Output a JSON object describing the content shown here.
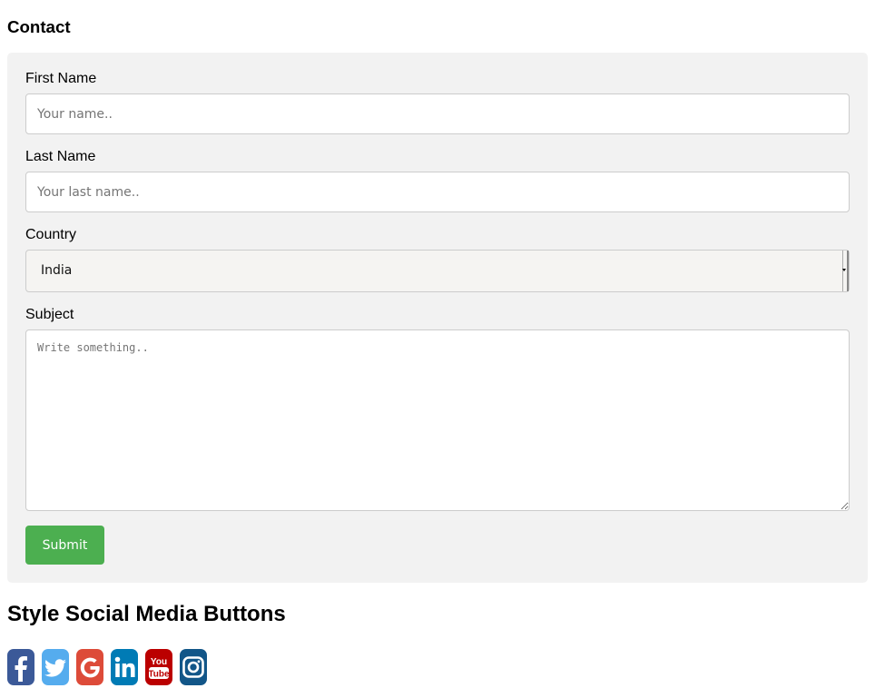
{
  "contact": {
    "title": "Contact",
    "first_name": {
      "label": "First Name",
      "placeholder": "Your name..",
      "value": ""
    },
    "last_name": {
      "label": "Last Name",
      "placeholder": "Your last name..",
      "value": ""
    },
    "country": {
      "label": "Country",
      "selected": "India"
    },
    "subject": {
      "label": "Subject",
      "placeholder": "Write something..",
      "value": ""
    },
    "submit_label": "Submit"
  },
  "social": {
    "title": "Style Social Media Buttons",
    "icons": [
      {
        "name": "facebook-icon",
        "color": "#3b5998"
      },
      {
        "name": "twitter-icon",
        "color": "#55acee"
      },
      {
        "name": "google-icon",
        "color": "#dd4b39"
      },
      {
        "name": "linkedin-icon",
        "color": "#007bb5"
      },
      {
        "name": "youtube-icon",
        "color": "#bb0000"
      },
      {
        "name": "instagram-icon",
        "color": "#125688"
      }
    ]
  },
  "colors": {
    "submit_bg": "#4caf50",
    "form_bg": "#f2f2f2"
  }
}
